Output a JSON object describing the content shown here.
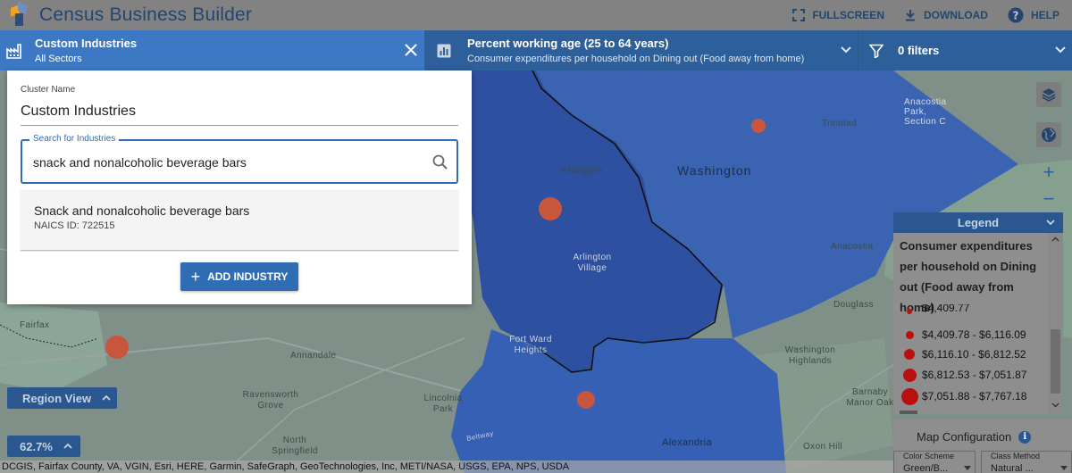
{
  "header": {
    "title": "Census Business Builder",
    "actions": [
      {
        "label": "FULLSCREEN",
        "icon": "fullscreen-icon"
      },
      {
        "label": "DOWNLOAD",
        "icon": "download-icon"
      },
      {
        "label": "HELP",
        "icon": "help-icon"
      }
    ]
  },
  "industries_bar": {
    "title": "Custom Industries",
    "subtitle": "All Sectors"
  },
  "variable_selector": {
    "title": "Percent working age (25 to 64 years)",
    "subtitle": "Consumer expenditures per household on Dining out (Food away from home)"
  },
  "filters": {
    "label": "0 filters"
  },
  "industry_panel": {
    "cluster_label": "Cluster Name",
    "cluster_value": "Custom Industries",
    "search_label": "Search for Industries",
    "search_value": "snack and nonalcoholic beverage bars",
    "result": {
      "name": "Snack and nonalcoholic beverage bars",
      "naics": "NAICS ID: 722515"
    },
    "add_button": "ADD INDUSTRY"
  },
  "map": {
    "labels": {
      "arlington": "Arlington",
      "washington": "Washington",
      "trinidad": "Trinidad",
      "anacostia_park": "Anacostia Park, Section C",
      "arlington_village": "Arlington Village",
      "anacostia": "Anacostia",
      "douglass": "Douglass",
      "fairfax": "Fairfax",
      "annandale": "Annandale",
      "fort_ward": "Fort Ward Heights",
      "ravensworth": "Ravensworth Grove",
      "lincolnia": "Lincolnia Park",
      "washington_highlands": "Washington Highlands",
      "barnaby": "Barnaby Manor Oak",
      "north_springfield": "North Springfield",
      "alexandria": "Alexandria",
      "oxon_hill": "Oxon Hill",
      "beltway": "Beltway"
    },
    "region_view": "Region View",
    "zoom_level": "62.7%",
    "attribution": "DCGIS, Fairfax County, VA, VGIN, Esri, HERE, Garmin, SafeGraph, GeoTechnologies, Inc, METI/NASA, USGS, EPA, NPS, USDA"
  },
  "legend": {
    "header": "Legend",
    "title_lines": [
      "Consumer expenditures",
      "per household on Dining",
      "out (Food away from",
      "home)"
    ],
    "items": [
      {
        "label": "$4,409.77"
      },
      {
        "label": "$4,409.78 - $6,116.09"
      },
      {
        "label": "$6,116.10 - $6,812.52"
      },
      {
        "label": "$6,812.53 - $7,051.87"
      },
      {
        "label": "$7,051.88 - $7,767.18"
      }
    ],
    "dot_color": "#b90f0f"
  },
  "map_config": {
    "title": "Map Configuration",
    "color_scheme_label": "Color Scheme",
    "color_scheme_value": "Green/B...",
    "class_method_label": "Class Method",
    "class_method_value": "Natural ..."
  },
  "colors": {
    "accent": "#3c78c4",
    "bar_dark": "#2d5f9b",
    "map_region": "#2f5aa8",
    "marker": "#c8563e"
  }
}
